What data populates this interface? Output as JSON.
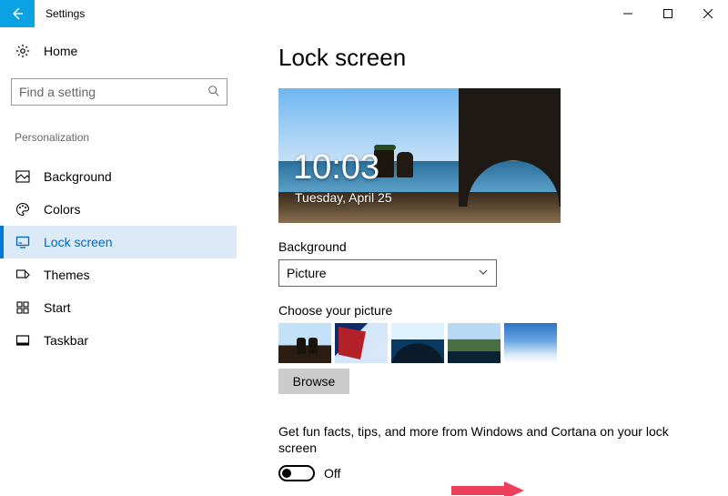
{
  "window": {
    "title": "Settings"
  },
  "sidebar": {
    "home": "Home",
    "search_placeholder": "Find a setting",
    "group": "Personalization",
    "items": [
      {
        "label": "Background"
      },
      {
        "label": "Colors"
      },
      {
        "label": "Lock screen"
      },
      {
        "label": "Themes"
      },
      {
        "label": "Start"
      },
      {
        "label": "Taskbar"
      }
    ],
    "active_index": 2
  },
  "page": {
    "title": "Lock screen",
    "preview": {
      "time": "10:03",
      "date": "Tuesday, April 25"
    },
    "background_label": "Background",
    "background_value": "Picture",
    "choose_label": "Choose your picture",
    "thumb_count": 5,
    "browse_label": "Browse",
    "fun_text": "Get fun facts, tips, and more from Windows and Cortana on your lock screen",
    "toggle_state": "Off"
  },
  "colors": {
    "accent": "#0078d7",
    "annotation": "#ec3f5a"
  }
}
